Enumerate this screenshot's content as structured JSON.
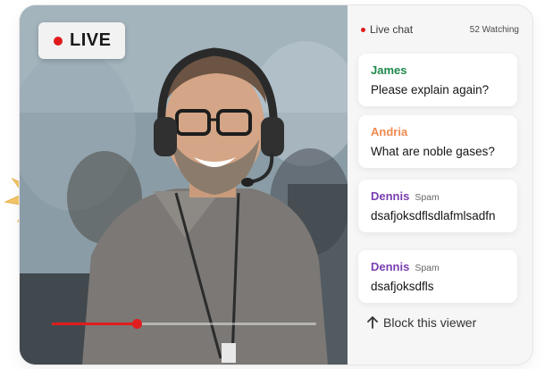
{
  "video": {
    "live_label": "LIVE",
    "progress": 0.32,
    "colors": {
      "live_dot": "#e01b1b",
      "progress": "#e11d1d"
    }
  },
  "chat": {
    "title": "Live chat",
    "watching": "52 Watching",
    "messages": [
      {
        "name": "James",
        "tag": "",
        "text": "Please explain again?",
        "color": "#1f8a4c"
      },
      {
        "name": "Andria",
        "tag": "",
        "text": "What are noble gases?",
        "color": "#f08a52"
      },
      {
        "name": "Dennis",
        "tag": "Spam",
        "text": "dsafjoksdflsdlafmlsadfn",
        "color": "#7a3fb0"
      },
      {
        "name": "Dennis",
        "tag": "Spam",
        "text": "dsafjoksdfls",
        "color": "#7a3fb0"
      }
    ],
    "block_label": "Block this viewer",
    "block_icon": "arrow-up-icon"
  }
}
